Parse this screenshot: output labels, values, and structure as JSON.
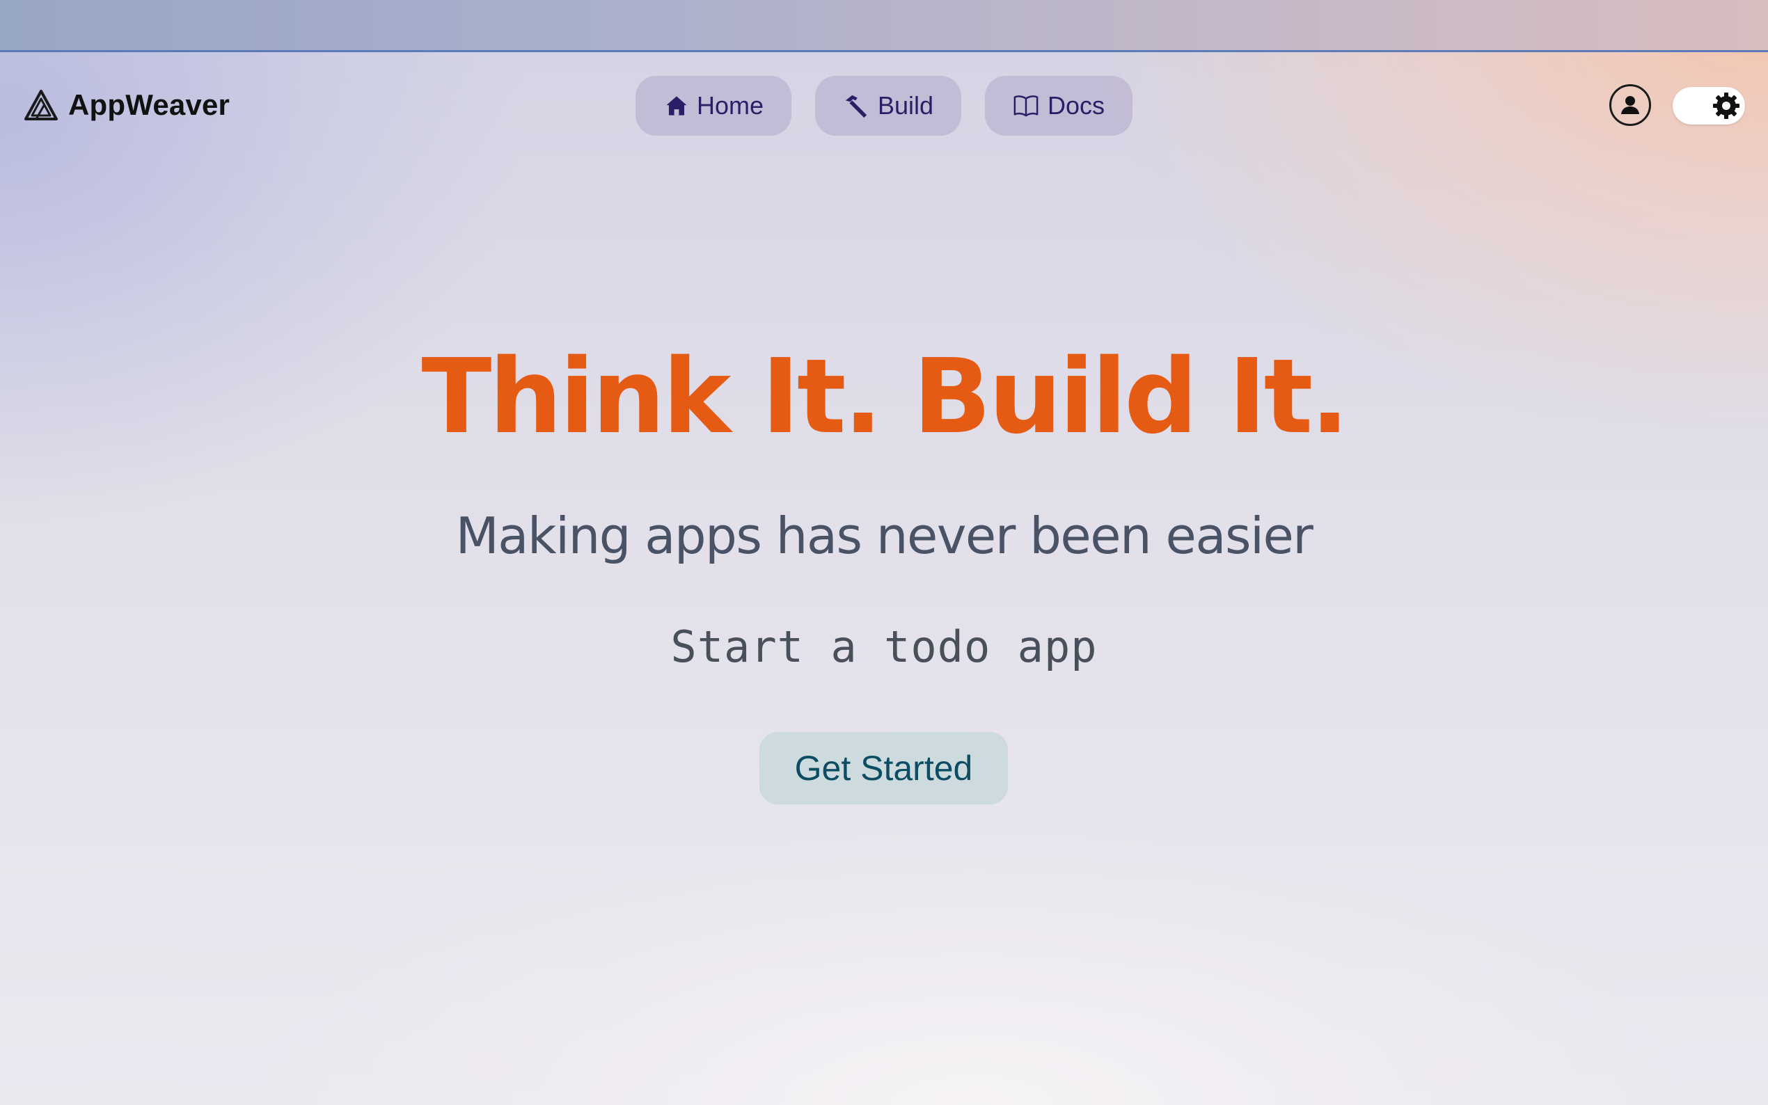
{
  "brand": {
    "name": "AppWeaver",
    "logo_icon": "triangle-logo-icon"
  },
  "nav": {
    "items": [
      {
        "label": "Home",
        "icon": "home-icon"
      },
      {
        "label": "Build",
        "icon": "hammer-icon"
      },
      {
        "label": "Docs",
        "icon": "book-icon"
      }
    ]
  },
  "header_actions": {
    "user_icon": "user-circle-icon",
    "theme_toggle_icon": "gear-icon"
  },
  "hero": {
    "title": "Think It. Build It.",
    "subtitle": "Making apps has never been easier",
    "typing_text": "Start a todo app",
    "cta_label": "Get Started"
  },
  "colors": {
    "accent": "#e55b14",
    "nav_text": "#2a1f66",
    "cta_text": "#0d4d63",
    "subtitle_text": "#4a5266"
  }
}
